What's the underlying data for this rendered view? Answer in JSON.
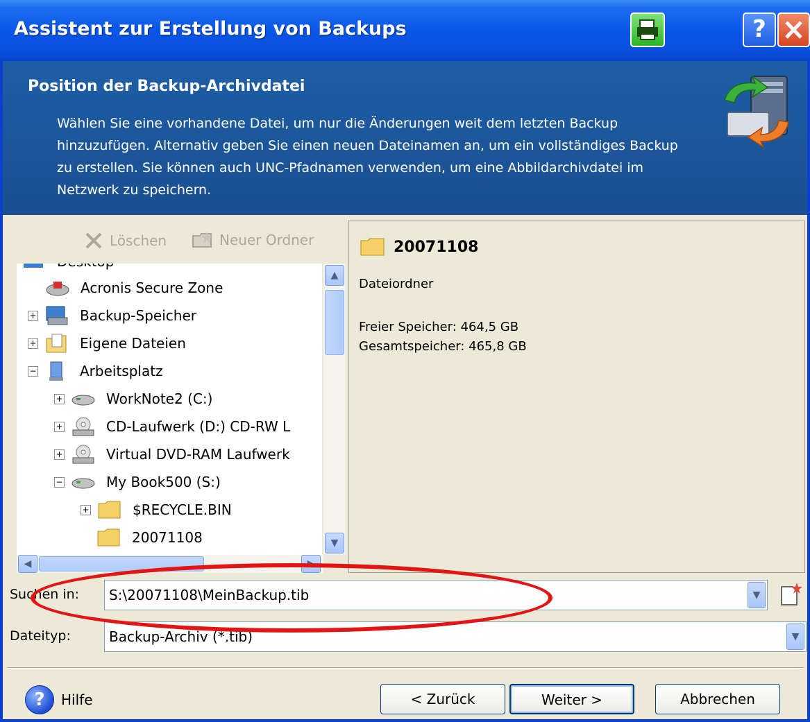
{
  "window": {
    "title": "Assistent zur Erstellung von Backups",
    "help_button": "?"
  },
  "header": {
    "title": "Position der Backup-Archivdatei",
    "description": "Wählen Sie eine vorhandene Datei, um nur die Änderungen weit dem letzten Backup hinzuzufügen. Alternativ geben Sie einen neuen Dateinamen an, um ein vollständiges Backup zu erstellen. Sie können auch UNC-Pfadnamen verwenden, um eine Abbildarchivdatei im Netzwerk zu speichern."
  },
  "toolbar": {
    "delete_label": "Löschen",
    "new_folder_label": "Neuer Ordner"
  },
  "tree": {
    "items": [
      {
        "label": "Desktop",
        "expander": "",
        "icon": "desktop-icon"
      },
      {
        "label": "Acronis Secure Zone",
        "expander": "",
        "icon": "secure-zone-icon"
      },
      {
        "label": "Backup-Speicher",
        "expander": "+",
        "icon": "backup-storage-icon"
      },
      {
        "label": "Eigene Dateien",
        "expander": "+",
        "icon": "my-documents-icon"
      },
      {
        "label": "Arbeitsplatz",
        "expander": "−",
        "icon": "computer-icon"
      },
      {
        "label": "WorkNote2 (C:)",
        "expander": "+",
        "icon": "hard-drive-icon"
      },
      {
        "label": "CD-Laufwerk (D:) CD-RW L",
        "expander": "+",
        "icon": "cd-drive-icon"
      },
      {
        "label": "Virtual DVD-RAM Laufwerk",
        "expander": "+",
        "icon": "dvd-drive-icon"
      },
      {
        "label": "My Book500 (S:)",
        "expander": "−",
        "icon": "hard-drive-icon"
      },
      {
        "label": "$RECYCLE.BIN",
        "expander": "+",
        "icon": "folder-icon"
      },
      {
        "label": "20071108",
        "expander": "",
        "icon": "folder-icon"
      }
    ]
  },
  "details": {
    "folder_name": "20071108",
    "type": "Dateiordner",
    "free_space": "Freier Speicher: 464,5 GB",
    "total_space": "Gesamtspeicher: 465,8 GB"
  },
  "path_row": {
    "label": "Suchen in:",
    "value": "S:\\20071108\\MeinBackup.tib"
  },
  "filetype_row": {
    "label": "Dateityp:",
    "value": "Backup-Archiv (*.tib)"
  },
  "footer": {
    "help_label": "Hilfe",
    "back_label": "< Zurück",
    "next_label": "Weiter >",
    "cancel_label": "Abbrechen"
  },
  "colors": {
    "title_bar": "#0a56e8",
    "header_bg": "#1e5ea6",
    "annotation_ring": "#e31414",
    "dialog_bg": "#ece9d8"
  }
}
